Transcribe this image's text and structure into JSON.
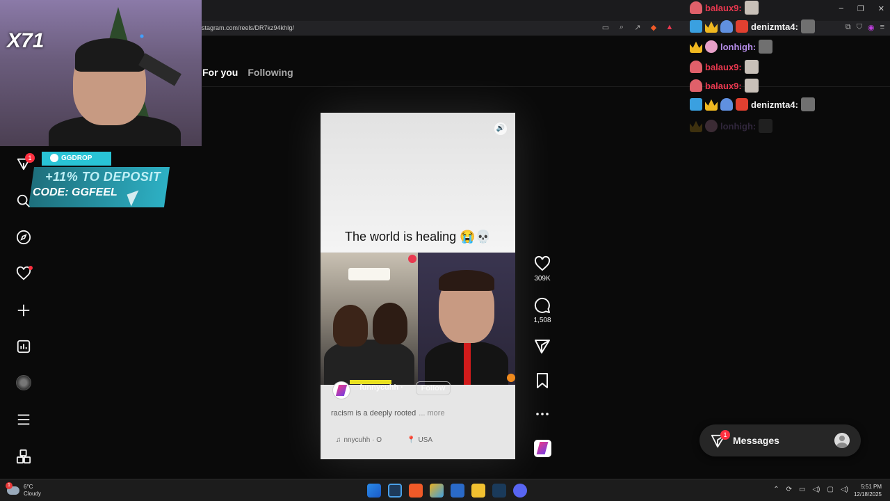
{
  "browser": {
    "url": "stagram.com/reels/DR7kz94khIg/"
  },
  "stream": {
    "webcam_counter": "X71",
    "ad": {
      "brand": "GGDROP",
      "promo_line1": "+11% TO DEPOSIT",
      "promo_line2": "CODE: GGFEEL"
    }
  },
  "nav": {
    "notification_count": "1"
  },
  "feed": {
    "tab_for_you": "For you",
    "tab_following": "Following"
  },
  "reel": {
    "caption": "The world is healing 😭💀",
    "author": "funnycuhh",
    "author_separator": "·",
    "follow_label": "Follow",
    "description": "racism is a deeply rooted",
    "more_label": "... more",
    "audio": "nnycuhh · O",
    "location": "USA"
  },
  "actions": {
    "likes": "309K",
    "comments": "1,508"
  },
  "chat": [
    {
      "name": "balaux9:",
      "color": "red",
      "badges": [
        "ghost"
      ],
      "emote": "light"
    },
    {
      "name": "denizmta4:",
      "color": "white",
      "badges": [
        "hammer",
        "crown",
        "ghost2",
        "emoji"
      ],
      "emote": "dark"
    },
    {
      "name": "lonhigh:",
      "color": "purple",
      "badges": [
        "crown",
        "pig"
      ],
      "emote": "dark"
    },
    {
      "name": "balaux9:",
      "color": "red",
      "badges": [
        "ghost"
      ],
      "emote": "light"
    },
    {
      "name": "balaux9:",
      "color": "red",
      "badges": [
        "ghost"
      ],
      "emote": "light"
    },
    {
      "name": "denizmta4:",
      "color": "white",
      "badges": [
        "hammer",
        "crown",
        "ghost2",
        "emoji"
      ],
      "emote": "dark"
    },
    {
      "name": "lonhigh:",
      "color": "purple",
      "badges": [
        "crown",
        "pig"
      ],
      "emote": "dark",
      "faded": true
    }
  ],
  "messages": {
    "label": "Messages",
    "count": "1"
  },
  "taskbar": {
    "weather_badge": "1",
    "temperature": "6°C",
    "condition": "Cloudy",
    "time": "5:51 PM",
    "date": "12/18/2025"
  },
  "icons": {
    "nav": [
      "instagram-filter-icon",
      "search-icon",
      "explore-icon",
      "heart-icon",
      "create-icon",
      "dashboard-icon",
      "profile-icon",
      "menu-icon",
      "more-apps-icon"
    ],
    "actions": [
      "like-icon",
      "comment-icon",
      "share-icon",
      "save-icon",
      "more-icon"
    ]
  }
}
